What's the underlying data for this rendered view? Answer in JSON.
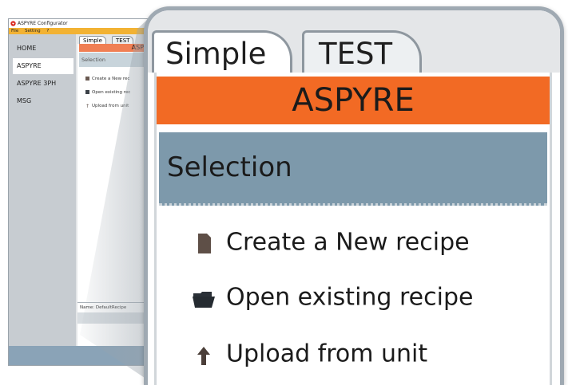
{
  "app": {
    "title": "ASPYRE Configurator"
  },
  "menu": {
    "items": [
      "File",
      "Setting",
      "?"
    ]
  },
  "sidebar": {
    "items": [
      {
        "label": "HOME",
        "active": false
      },
      {
        "label": "ASPYRE",
        "active": true
      },
      {
        "label": "ASPYRE 3PH",
        "active": false
      },
      {
        "label": "MSG",
        "active": false
      }
    ]
  },
  "tabs": [
    {
      "label": "Simple",
      "active": true
    },
    {
      "label": "TEST",
      "active": false
    }
  ],
  "banner": {
    "label": "ASPYRE",
    "color": "#f26a24"
  },
  "selection": {
    "header": "Selection"
  },
  "actions": [
    {
      "label": "Create a New recipe",
      "mini_label": "Create a New rec",
      "icon": "document-icon"
    },
    {
      "label": "Open existing recipe",
      "mini_label": "Open existing rec",
      "icon": "folder-open-icon"
    },
    {
      "label": "Upload from unit",
      "mini_label": "Upload from unit",
      "icon": "upload-arrow-icon"
    }
  ],
  "recipe": {
    "name_label": "Name: DefaultRecipe"
  },
  "colors": {
    "menu_bar": "#f2b233",
    "selection_bg": "#7d99ab",
    "status_bar": "#8aa3b7"
  }
}
